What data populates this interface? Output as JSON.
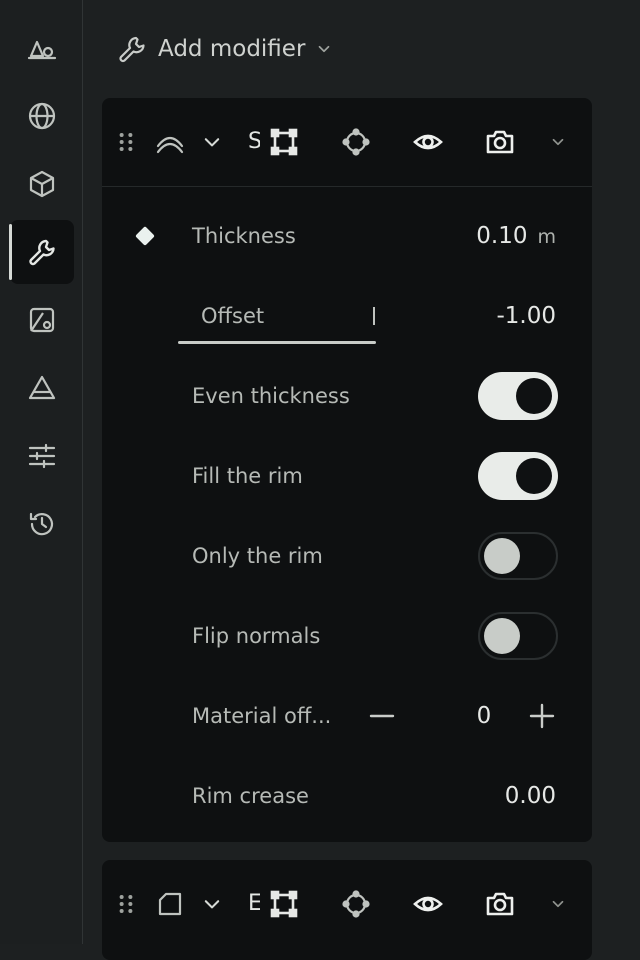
{
  "sidebar": {
    "items": [
      {
        "name": "sidebar-item-tool",
        "icon": "shapes-icon"
      },
      {
        "name": "sidebar-item-world",
        "icon": "globe-icon"
      },
      {
        "name": "sidebar-item-object",
        "icon": "cube-icon"
      },
      {
        "name": "sidebar-item-modifiers",
        "icon": "wrench-icon",
        "active": true
      },
      {
        "name": "sidebar-item-particles",
        "icon": "paint-icon"
      },
      {
        "name": "sidebar-item-physics",
        "icon": "triangle-icon"
      },
      {
        "name": "sidebar-item-constraints",
        "icon": "sliders-icon"
      },
      {
        "name": "sidebar-item-history",
        "icon": "history-icon"
      }
    ]
  },
  "toolbar": {
    "add_modifier_label": "Add modifier"
  },
  "modifier1": {
    "name_truncated": "S",
    "properties": {
      "thickness_label": "Thickness",
      "thickness_value": "0.10",
      "thickness_unit": "m",
      "offset_label": "Offset",
      "offset_value": "-1.00",
      "even_thickness_label": "Even thickness",
      "even_thickness_on": true,
      "fill_rim_label": "Fill the rim",
      "fill_rim_on": true,
      "only_rim_label": "Only the rim",
      "only_rim_on": false,
      "flip_normals_label": "Flip normals",
      "flip_normals_on": false,
      "material_offset_label": "Material off...",
      "material_offset_value": "0",
      "rim_crease_label": "Rim crease",
      "rim_crease_value": "0.00"
    }
  },
  "modifier2": {
    "name_truncated": "E"
  },
  "colors": {
    "background": "#1d2021",
    "panel": "#0e1011",
    "toggle_on": "#e9ece9",
    "text": "#e6e8e6"
  }
}
